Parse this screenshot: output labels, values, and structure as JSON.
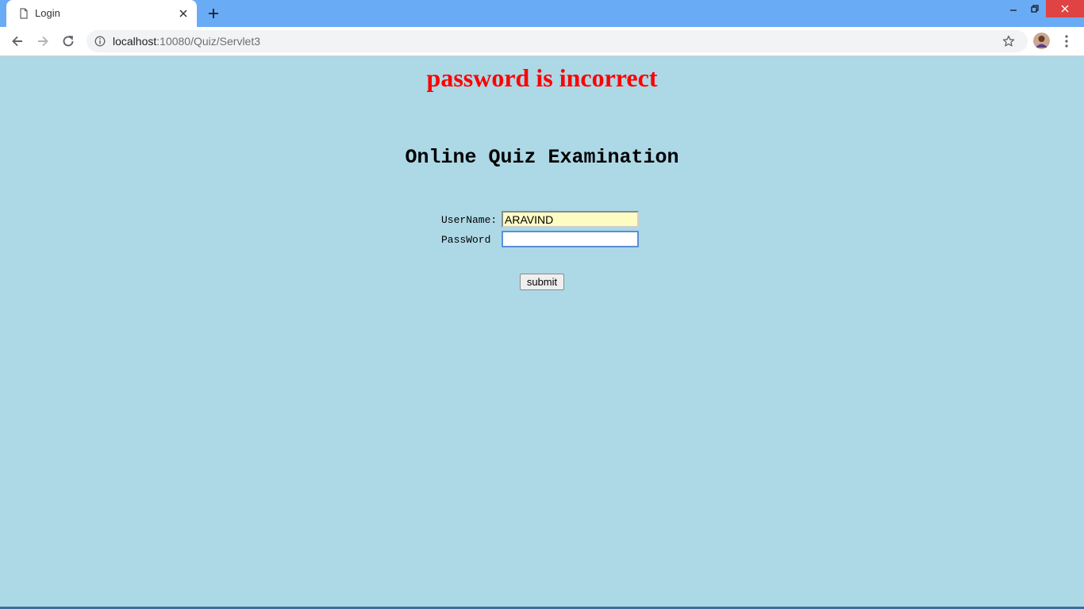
{
  "browser": {
    "tab": {
      "title": "Login",
      "favicon_icon": "page-icon",
      "close_icon": "close-icon"
    },
    "new_tab_icon": "plus-icon",
    "window_controls": {
      "minimize_icon": "minimize-icon",
      "restore_icon": "restore-icon",
      "close_icon": "close-icon"
    },
    "toolbar": {
      "back_icon": "back-arrow-icon",
      "forward_icon": "forward-arrow-icon",
      "reload_icon": "reload-icon",
      "site_info_icon": "info-icon",
      "url_host": "localhost",
      "url_rest": ":10080/Quiz/Servlet3",
      "bookmark_icon": "star-icon",
      "menu_icon": "kebab-menu-icon"
    }
  },
  "page": {
    "error_message": "password is incorrect",
    "title": "Online Quiz Examination",
    "form": {
      "username_label": "UserName: :",
      "username_value": "ARAVIND",
      "password_label": "PassWord  :",
      "password_value": "",
      "submit_label": "submit"
    }
  },
  "colors": {
    "page_background": "#add8e6",
    "error_text": "#ff0000",
    "tabstrip": "#6aabf5",
    "autofill_background": "#fdfcc3",
    "close_button": "#e04343"
  }
}
